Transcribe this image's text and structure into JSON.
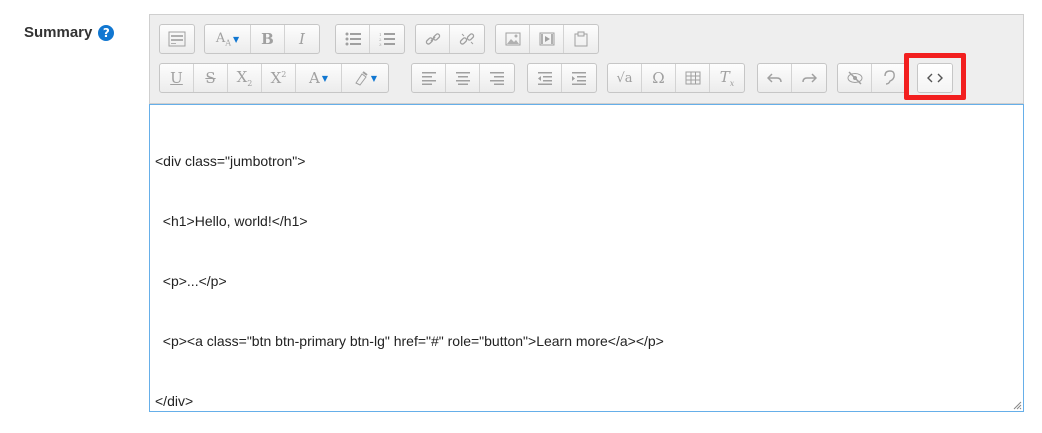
{
  "field": {
    "label": "Summary",
    "help_glyph": "?"
  },
  "toolbar": {
    "row1": [
      {
        "name": "show-more-buttons",
        "icon": "toolbar-toggle-icon"
      },
      {
        "name": "paragraph-styles",
        "icon": "paragraph-styles-icon"
      },
      {
        "name": "bold",
        "icon": "bold-icon",
        "text": "B"
      },
      {
        "name": "italic",
        "icon": "italic-icon",
        "text": "I"
      },
      {
        "name": "unordered-list",
        "icon": "unordered-list-icon"
      },
      {
        "name": "ordered-list",
        "icon": "ordered-list-icon"
      },
      {
        "name": "link",
        "icon": "link-icon"
      },
      {
        "name": "unlink",
        "icon": "unlink-icon"
      },
      {
        "name": "image",
        "icon": "image-icon"
      },
      {
        "name": "media",
        "icon": "media-icon"
      },
      {
        "name": "manage-files",
        "icon": "files-icon"
      }
    ],
    "row2": [
      {
        "name": "underline",
        "icon": "underline-icon",
        "text": "U"
      },
      {
        "name": "strikethrough",
        "icon": "strikethrough-icon",
        "text": "S"
      },
      {
        "name": "subscript",
        "icon": "subscript-icon",
        "text": "X2"
      },
      {
        "name": "superscript",
        "icon": "superscript-icon",
        "text": "X2"
      },
      {
        "name": "font-color",
        "icon": "font-color-icon"
      },
      {
        "name": "background-color",
        "icon": "background-color-icon"
      },
      {
        "name": "align-left",
        "icon": "align-left-icon"
      },
      {
        "name": "align-center",
        "icon": "align-center-icon"
      },
      {
        "name": "align-right",
        "icon": "align-right-icon"
      },
      {
        "name": "outdent",
        "icon": "outdent-icon"
      },
      {
        "name": "indent",
        "icon": "indent-icon"
      },
      {
        "name": "equation",
        "icon": "equation-icon"
      },
      {
        "name": "special-character",
        "icon": "omega-icon",
        "text": "Ω"
      },
      {
        "name": "table",
        "icon": "table-icon"
      },
      {
        "name": "clear-formatting",
        "icon": "clear-formatting-icon",
        "text": "Tx"
      },
      {
        "name": "undo",
        "icon": "undo-icon"
      },
      {
        "name": "redo",
        "icon": "redo-icon"
      },
      {
        "name": "accessibility-checker",
        "icon": "eye-slash-icon"
      },
      {
        "name": "screenreader-helper",
        "icon": "ear-icon"
      },
      {
        "name": "html-source",
        "icon": "code-icon",
        "text": "<>"
      }
    ],
    "highlight_color": "#f21f1f",
    "accent_color": "#1177d1"
  },
  "editor": {
    "lines": [
      "<div class=\"jumbotron\">",
      "  <h1>Hello, world!</h1>",
      "  <p>...</p>",
      "  <p><a class=\"btn btn-primary btn-lg\" href=\"#\" role=\"button\">Learn more</a></p>",
      "</div>"
    ],
    "border_color": "#66afe9"
  }
}
